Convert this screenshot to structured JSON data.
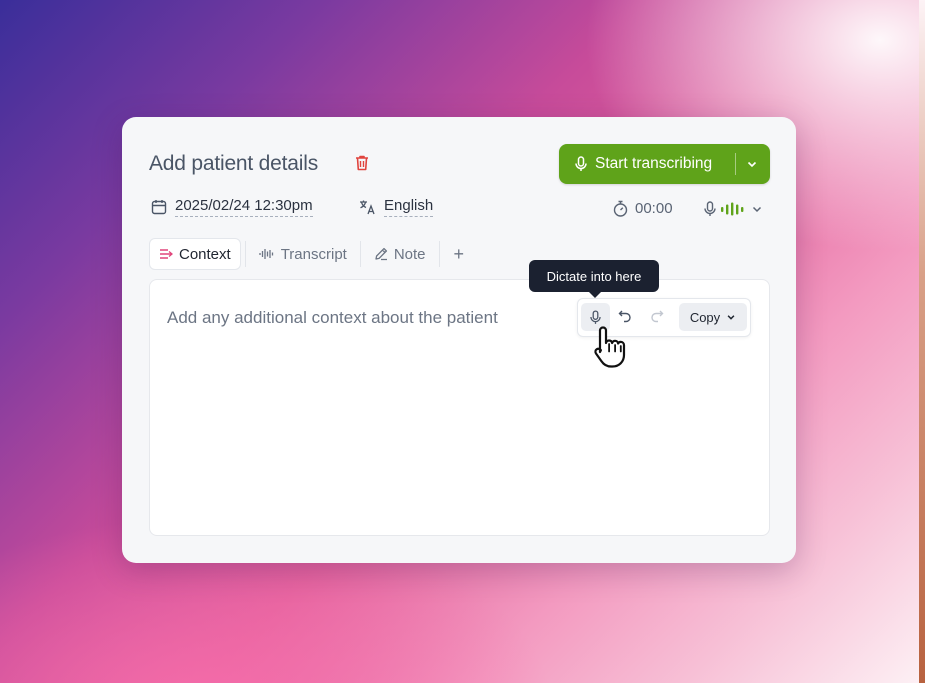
{
  "header": {
    "title": "Add patient details",
    "start_button_label": "Start transcribing"
  },
  "meta": {
    "datetime": "2025/02/24 12:30pm",
    "language": "English",
    "timer": "00:00"
  },
  "tabs": [
    {
      "label": "Context",
      "active": true
    },
    {
      "label": "Transcript",
      "active": false
    },
    {
      "label": "Note",
      "active": false
    }
  ],
  "add_tab_label": "+",
  "editor": {
    "placeholder": "Add any additional context about the patient",
    "copy_label": "Copy",
    "tooltip": "Dictate into here"
  },
  "colors": {
    "accent_green": "#5fa31a",
    "delete_red": "#e0443e",
    "context_pink": "#e0457b"
  },
  "icons": [
    "trash-icon",
    "mic-icon",
    "chevron-down-icon",
    "calendar-icon",
    "translate-icon",
    "stopwatch-icon",
    "audio-level-icon",
    "lines-icon",
    "waveform-icon",
    "pencil-icon",
    "undo-icon",
    "redo-icon",
    "hand-pointer-icon"
  ]
}
